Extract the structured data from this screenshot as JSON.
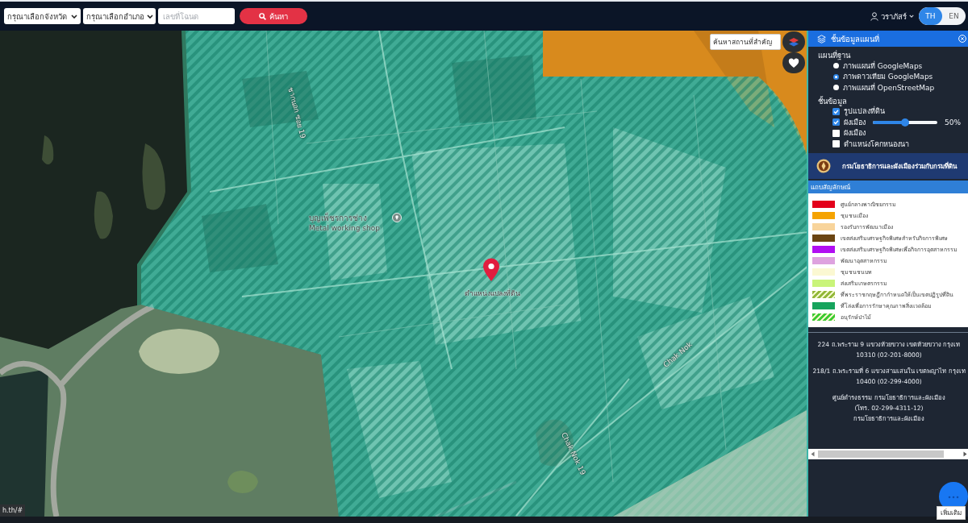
{
  "topbar": {
    "province_select": {
      "value": "กรุณาเลือกจังหวัด"
    },
    "district_select": {
      "value": "กรุณาเลือกอำเภอ"
    },
    "deed_field": {
      "placeholder": "เลขที่โฉนด"
    },
    "search_button": {
      "label": "ค้นหา"
    },
    "user": {
      "name": "วราภัสร์"
    },
    "languages": [
      {
        "label": "TH",
        "selected": true
      },
      {
        "label": "EN",
        "selected": false
      }
    ]
  },
  "map": {
    "search": {
      "placeholder": "ค้นหาสถานที่สำคัญ"
    },
    "roads": [
      {
        "name": "ชากนอก ซอย 19"
      },
      {
        "name": "Chak Nok"
      },
      {
        "name": "Chak Nok 19"
      }
    ],
    "place": {
      "name": "บุญเพ็ชรการช่าง",
      "subtitle": "Metal working shop"
    },
    "marker": {
      "label": "ตำแหน่งแปลงที่ดิน"
    },
    "status_url": "h.th/#"
  },
  "layer_panel": {
    "title": "ชั้นข้อมูลแผนที่",
    "base_map": {
      "heading": "แผนที่ฐาน",
      "options": [
        {
          "label": "ภาพแผนที่ GoogleMaps",
          "selected": false
        },
        {
          "label": "ภาพดาวเทียม GoogleMaps",
          "selected": true
        },
        {
          "label": "ภาพแผนที่ OpenStreetMap",
          "selected": false
        }
      ]
    },
    "layers": {
      "heading": "ชั้นข้อมูล",
      "items": [
        {
          "kind": "checkbox",
          "label": "รูปแปลงที่ดิน",
          "checked": true
        },
        {
          "kind": "slider",
          "label": "ผังเมือง",
          "checked": true,
          "level": 0.5,
          "reading": "50%"
        },
        {
          "kind": "checkbox",
          "label": "ผังเมือง",
          "checked": false
        },
        {
          "kind": "checkbox",
          "label": "ตำแหน่งโคกหนองนา",
          "checked": false
        }
      ]
    },
    "agency_banner": "กรมโยธาธิการและผังเมืองร่วมกับกรมที่ดิน",
    "legend": {
      "title": "แถบสัญลักษณ์",
      "items": [
        {
          "kind": "solid",
          "color": "#e3001b",
          "label": "ศูนย์กลางพาณิชยกรรม"
        },
        {
          "kind": "solid",
          "color": "#f5a300",
          "label": "ชุมชนเมือง"
        },
        {
          "kind": "solid",
          "color": "#f8d49b",
          "label": "รองรับการพัฒนาเมือง"
        },
        {
          "kind": "solid",
          "color": "#6b4513",
          "label": "เขตส่งเสริมเศรษฐกิจพิเศษสำหรับกิจการพิเศษ"
        },
        {
          "kind": "solid",
          "color": "#b10ef2",
          "label": "เขตส่งเสริมเศรษฐกิจพิเศษเพื่อกิจการอุตสาหกรรม"
        },
        {
          "kind": "solid",
          "color": "#dea2df",
          "label": "พัฒนาอุตสาหกรรม"
        },
        {
          "kind": "solid",
          "color": "#fbf8d2",
          "label": "ชุมชนชนบท"
        },
        {
          "kind": "solid",
          "color": "#c9f47a",
          "label": "ส่งเสริมเกษตรกรรม"
        },
        {
          "kind": "hatched",
          "color": "#93b83a",
          "label": "ที่พระราชกฤษฎีกากำหนดให้เป็นเขตปฏิรูปที่ดิน"
        },
        {
          "kind": "solid",
          "color": "#17a45d",
          "label": "ที่โล่งเพื่อการรักษาคุณภาพสิ่งแวดล้อม"
        },
        {
          "kind": "hatched",
          "color": "#3ecb32",
          "label": "อนุรักษ์ป่าไม้"
        }
      ]
    },
    "contacts": [
      {
        "lines": [
          "224 ถ.พระราม 9 แขวงห้วยขวาง เขตห้วยขวาง กรุงเท",
          "10310 (02-201-8000)"
        ]
      },
      {
        "lines": [
          "218/1 ถ.พระรามที่ 6 แขวงสามเสนใน เขตพญาไท กรุงเท",
          "10400 (02-299-4000)"
        ]
      },
      {
        "lines": [
          "ศูนย์ดำรงธรรม กรมโยธาธิการและผังเมือง",
          "(โทร. 02-299-4311-12)",
          "กรมโยธาธิการและผังเมือง"
        ]
      }
    ],
    "more_button": {
      "label": "เพิ่มเติม"
    }
  }
}
